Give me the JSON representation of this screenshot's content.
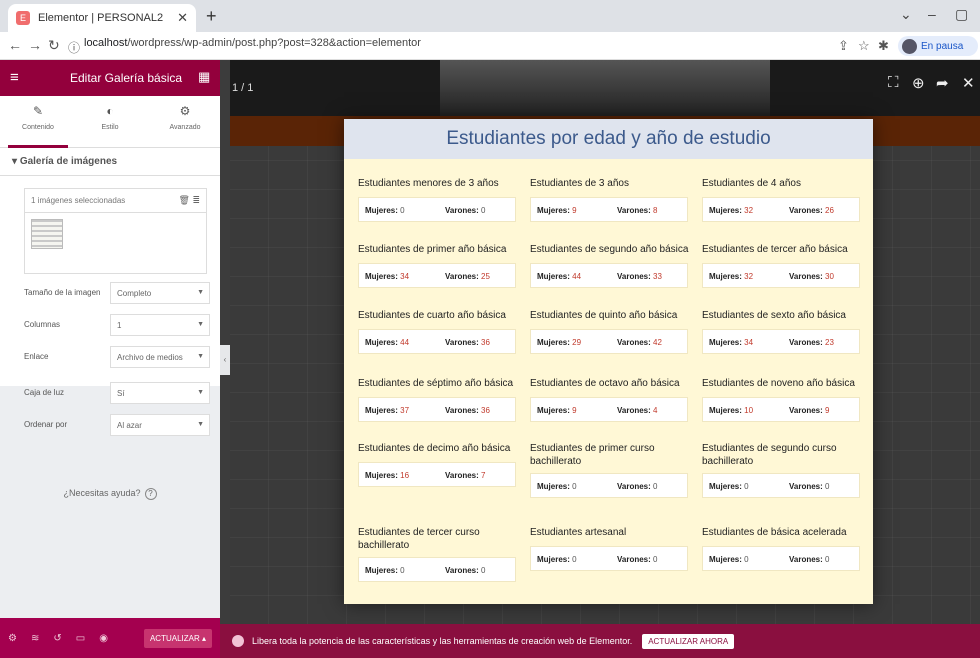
{
  "browser": {
    "tab_title": "Elementor | PERSONAL2",
    "address_host": "localhost",
    "address_path": "/wordpress/wp-admin/post.php?post=328&action=elementor",
    "profile_label": "En pausa"
  },
  "panel": {
    "header_title": "Editar Galería básica",
    "tabs": [
      {
        "label": "Contenido",
        "icon": "pencil-icon"
      },
      {
        "label": "Estilo",
        "icon": "half-circle-icon"
      },
      {
        "label": "Avanzado",
        "icon": "gear-icon"
      }
    ],
    "section_title": "Galería de imágenes",
    "gallery_selected": "1 imágenes seleccionadas",
    "controls": [
      {
        "label": "Tamaño de la imagen",
        "value": "Completo"
      },
      {
        "label": "Columnas",
        "value": "1"
      },
      {
        "label": "Enlace",
        "value": "Archivo de medios"
      },
      {
        "label": "Caja de luz",
        "value": "Sí"
      },
      {
        "label": "Ordenar por",
        "value": "Al azar"
      }
    ],
    "help_text": "¿Necesitas ayuda?",
    "update_button": "ACTUALIZAR"
  },
  "lightbox": {
    "counter": "1 / 1",
    "title": "Estudiantes por edad y año de estudio",
    "mujeres_label": "Mujeres:",
    "varones_label": "Varones:",
    "cells": [
      {
        "title": "Estudiantes menores de 3 años",
        "mujeres": "0",
        "varones": "0"
      },
      {
        "title": "Estudiantes de 3 años",
        "mujeres": "9",
        "varones": "8"
      },
      {
        "title": "Estudiantes de 4 años",
        "mujeres": "32",
        "varones": "26"
      },
      {
        "title": "Estudiantes de primer año básica",
        "mujeres": "34",
        "varones": "25"
      },
      {
        "title": "Estudiantes de segundo año básica",
        "mujeres": "44",
        "varones": "33"
      },
      {
        "title": "Estudiantes de tercer año básica",
        "mujeres": "32",
        "varones": "30"
      },
      {
        "title": "Estudiantes de cuarto año básica",
        "mujeres": "44",
        "varones": "36"
      },
      {
        "title": "Estudiantes de quinto año básica",
        "mujeres": "29",
        "varones": "42"
      },
      {
        "title": "Estudiantes de sexto año básica",
        "mujeres": "34",
        "varones": "23"
      },
      {
        "title": "Estudiantes de séptimo año básica",
        "mujeres": "37",
        "varones": "36"
      },
      {
        "title": "Estudiantes de octavo año básica",
        "mujeres": "9",
        "varones": "4"
      },
      {
        "title": "Estudiantes de noveno año básica",
        "mujeres": "10",
        "varones": "9"
      },
      {
        "title": "Estudiantes de decimo año básica",
        "mujeres": "16",
        "varones": "7"
      },
      {
        "title": "Estudiantes de primer curso bachillerato",
        "mujeres": "0",
        "varones": "0"
      },
      {
        "title": "Estudiantes de segundo curso bachillerato",
        "mujeres": "0",
        "varones": "0"
      },
      {
        "title": "Estudiantes de tercer curso bachillerato",
        "mujeres": "0",
        "varones": "0"
      },
      {
        "title": "Estudiantes artesanal",
        "mujeres": "0",
        "varones": "0"
      },
      {
        "title": "Estudiantes de básica acelerada",
        "mujeres": "0",
        "varones": "0"
      }
    ]
  },
  "notice": {
    "text": "Libera toda la potencia de las características y las herramientas de creación web de Elementor.",
    "cta": "ACTUALIZAR AHORA"
  },
  "colors": {
    "brand": "#93003c",
    "title_blue": "#3c5a8c",
    "card_bg": "#fff8d6",
    "value_red": "#c0392b"
  }
}
